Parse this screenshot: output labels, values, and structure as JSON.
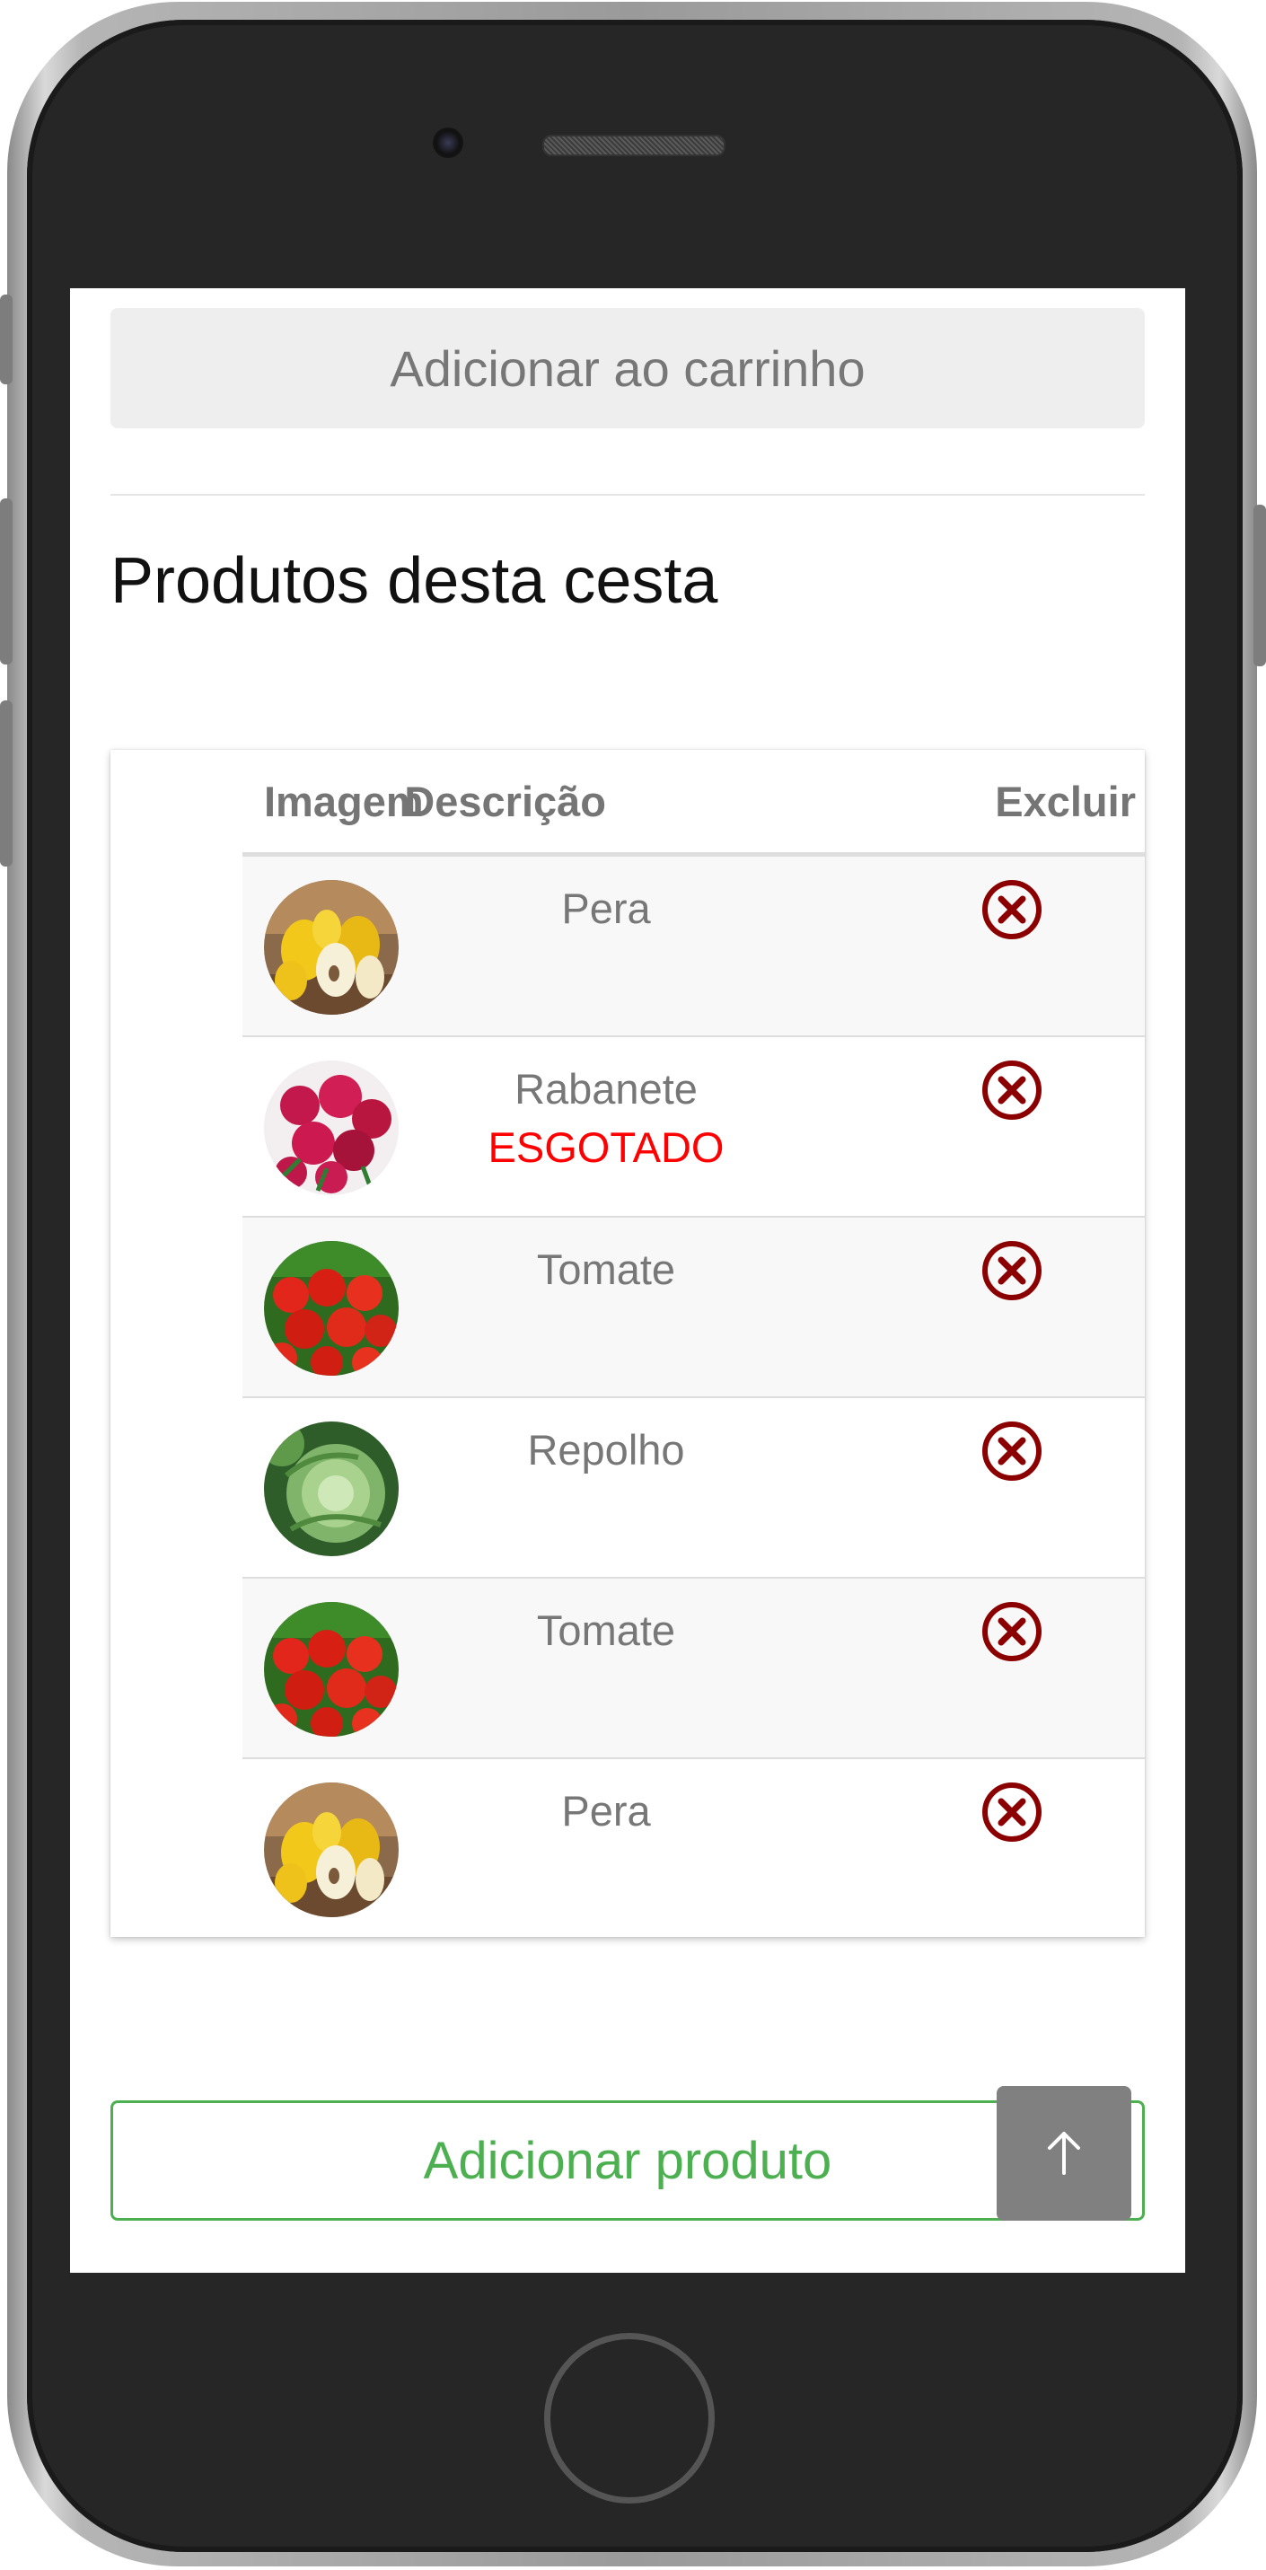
{
  "screen": {
    "cart_button_label": "Adicionar ao carrinho",
    "section_title": "Produtos desta cesta",
    "table": {
      "columns": {
        "image": "Imagem",
        "description": "Descrição",
        "delete": "Excluir"
      },
      "rows": [
        {
          "name": "Pera",
          "status": "",
          "image": "pear"
        },
        {
          "name": "Rabanete",
          "status": "ESGOTADO",
          "image": "radish"
        },
        {
          "name": "Tomate",
          "status": "",
          "image": "tomato"
        },
        {
          "name": "Repolho",
          "status": "",
          "image": "cabbage"
        },
        {
          "name": "Tomate",
          "status": "",
          "image": "tomato"
        },
        {
          "name": "Pera",
          "status": "",
          "image": "pear"
        }
      ]
    },
    "add_product_label": "Adicionar produto",
    "colors": {
      "delete_icon": "#8b0000",
      "sold_out": "#ff0000",
      "accent_green": "#4caf50"
    },
    "icons": {
      "delete": "close-circle-icon",
      "scroll_top": "arrow-up-icon"
    }
  }
}
